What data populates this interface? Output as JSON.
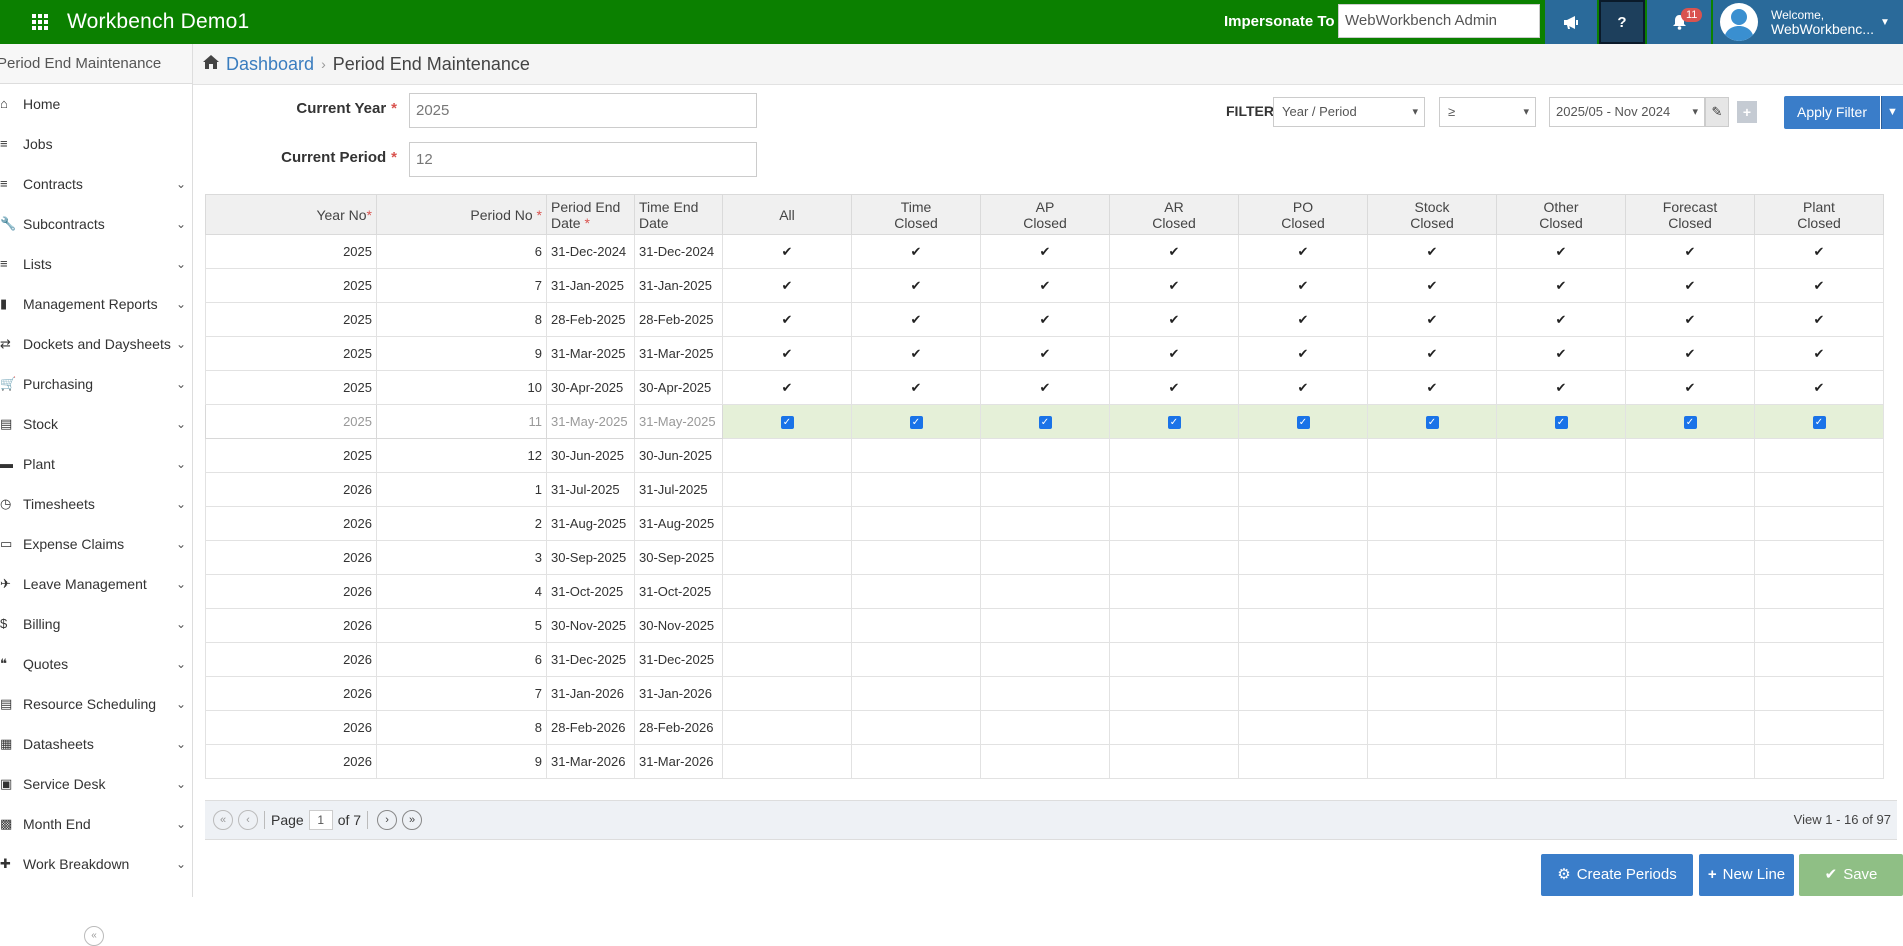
{
  "topbar": {
    "app_title": "Workbench Demo1",
    "impersonate_label": "Impersonate To",
    "impersonate_value": "WebWorkbench Admin",
    "help_label": "?",
    "notification_count": "11",
    "welcome_line1": "Welcome,",
    "welcome_line2": "WebWorkbenc..."
  },
  "sidebar": {
    "header": "Period End Maintenance",
    "items": [
      {
        "label": "Home",
        "icon": "home-icon",
        "chevron": false
      },
      {
        "label": "Jobs",
        "icon": "list-icon",
        "chevron": false
      },
      {
        "label": "Contracts",
        "icon": "list-icon",
        "chevron": true
      },
      {
        "label": "Subcontracts",
        "icon": "wrench-icon",
        "chevron": true
      },
      {
        "label": "Lists",
        "icon": "list-icon",
        "chevron": true
      },
      {
        "label": "Management Reports",
        "icon": "bar-chart-icon",
        "chevron": true
      },
      {
        "label": "Dockets and Daysheets",
        "icon": "exchange-icon",
        "chevron": true
      },
      {
        "label": "Purchasing",
        "icon": "cart-icon",
        "chevron": true
      },
      {
        "label": "Stock",
        "icon": "stock-icon",
        "chevron": true
      },
      {
        "label": "Plant",
        "icon": "truck-icon",
        "chevron": true
      },
      {
        "label": "Timesheets",
        "icon": "clock-icon",
        "chevron": true
      },
      {
        "label": "Expense Claims",
        "icon": "card-icon",
        "chevron": true
      },
      {
        "label": "Leave Management",
        "icon": "plane-icon",
        "chevron": true
      },
      {
        "label": "Billing",
        "icon": "dollar-icon",
        "chevron": true
      },
      {
        "label": "Quotes",
        "icon": "quote-icon",
        "chevron": true
      },
      {
        "label": "Resource Scheduling",
        "icon": "schedule-icon",
        "chevron": true
      },
      {
        "label": "Datasheets",
        "icon": "datasheet-icon",
        "chevron": true
      },
      {
        "label": "Service Desk",
        "icon": "service-icon",
        "chevron": true
      },
      {
        "label": "Month End",
        "icon": "month-end-icon",
        "chevron": true
      },
      {
        "label": "Work Breakdown",
        "icon": "puzzle-icon",
        "chevron": true
      }
    ]
  },
  "breadcrumb": {
    "link": "Dashboard",
    "separator": "›",
    "current": "Period End Maintenance"
  },
  "form": {
    "current_year_label": "Current Year",
    "current_year_value": "2025",
    "current_period_label": "Current Period",
    "current_period_value": "12",
    "required_mark": "*"
  },
  "filter": {
    "label": "FILTER",
    "field": "Year / Period",
    "operator": "≥",
    "value": "2025/05 - Nov 2024",
    "plus_label": "+",
    "apply_label": "Apply Filter"
  },
  "table": {
    "headers": {
      "year_no": "Year No",
      "period_no": "Period No",
      "period_end_1": "Period End",
      "period_end_2": "Date",
      "time_end_1": "Time End",
      "time_end_2": "Date",
      "all": "All",
      "time_1": "Time",
      "time_2": "Closed",
      "ap_1": "AP",
      "ap_2": "Closed",
      "ar_1": "AR",
      "ar_2": "Closed",
      "po_1": "PO",
      "po_2": "Closed",
      "stock_1": "Stock",
      "stock_2": "Closed",
      "other_1": "Other",
      "other_2": "Closed",
      "forecast_1": "Forecast",
      "forecast_2": "Closed",
      "plant_1": "Plant",
      "plant_2": "Closed"
    },
    "rows": [
      {
        "year": "2025",
        "period": "6",
        "period_end": "31-Dec-2024",
        "time_end": "31-Dec-2024",
        "state": "closed"
      },
      {
        "year": "2025",
        "period": "7",
        "period_end": "31-Jan-2025",
        "time_end": "31-Jan-2025",
        "state": "closed"
      },
      {
        "year": "2025",
        "period": "8",
        "period_end": "28-Feb-2025",
        "time_end": "28-Feb-2025",
        "state": "closed"
      },
      {
        "year": "2025",
        "period": "9",
        "period_end": "31-Mar-2025",
        "time_end": "31-Mar-2025",
        "state": "closed"
      },
      {
        "year": "2025",
        "period": "10",
        "period_end": "30-Apr-2025",
        "time_end": "30-Apr-2025",
        "state": "closed"
      },
      {
        "year": "2025",
        "period": "11",
        "period_end": "31-May-2025",
        "time_end": "31-May-2025",
        "state": "editing"
      },
      {
        "year": "2025",
        "period": "12",
        "period_end": "30-Jun-2025",
        "time_end": "30-Jun-2025",
        "state": "open"
      },
      {
        "year": "2026",
        "period": "1",
        "period_end": "31-Jul-2025",
        "time_end": "31-Jul-2025",
        "state": "open"
      },
      {
        "year": "2026",
        "period": "2",
        "period_end": "31-Aug-2025",
        "time_end": "31-Aug-2025",
        "state": "open"
      },
      {
        "year": "2026",
        "period": "3",
        "period_end": "30-Sep-2025",
        "time_end": "30-Sep-2025",
        "state": "open"
      },
      {
        "year": "2026",
        "period": "4",
        "period_end": "31-Oct-2025",
        "time_end": "31-Oct-2025",
        "state": "open"
      },
      {
        "year": "2026",
        "period": "5",
        "period_end": "30-Nov-2025",
        "time_end": "30-Nov-2025",
        "state": "open"
      },
      {
        "year": "2026",
        "period": "6",
        "period_end": "31-Dec-2025",
        "time_end": "31-Dec-2025",
        "state": "open"
      },
      {
        "year": "2026",
        "period": "7",
        "period_end": "31-Jan-2026",
        "time_end": "31-Jan-2026",
        "state": "open"
      },
      {
        "year": "2026",
        "period": "8",
        "period_end": "28-Feb-2026",
        "time_end": "28-Feb-2026",
        "state": "open"
      },
      {
        "year": "2026",
        "period": "9",
        "period_end": "31-Mar-2026",
        "time_end": "31-Mar-2026",
        "state": "open"
      }
    ]
  },
  "pager": {
    "page_label": "Page",
    "page_value": "1",
    "of_label": "of 7",
    "view_text": "View 1 - 16 of 97"
  },
  "actions": {
    "create_periods": "Create Periods",
    "new_line": "New Line",
    "save": "Save"
  },
  "colors": {
    "topbar": "#0b8000",
    "primary": "#3a7dc9",
    "save": "#8fbf85",
    "selected_row": "#e5f0d8",
    "required": "#d9534f"
  }
}
